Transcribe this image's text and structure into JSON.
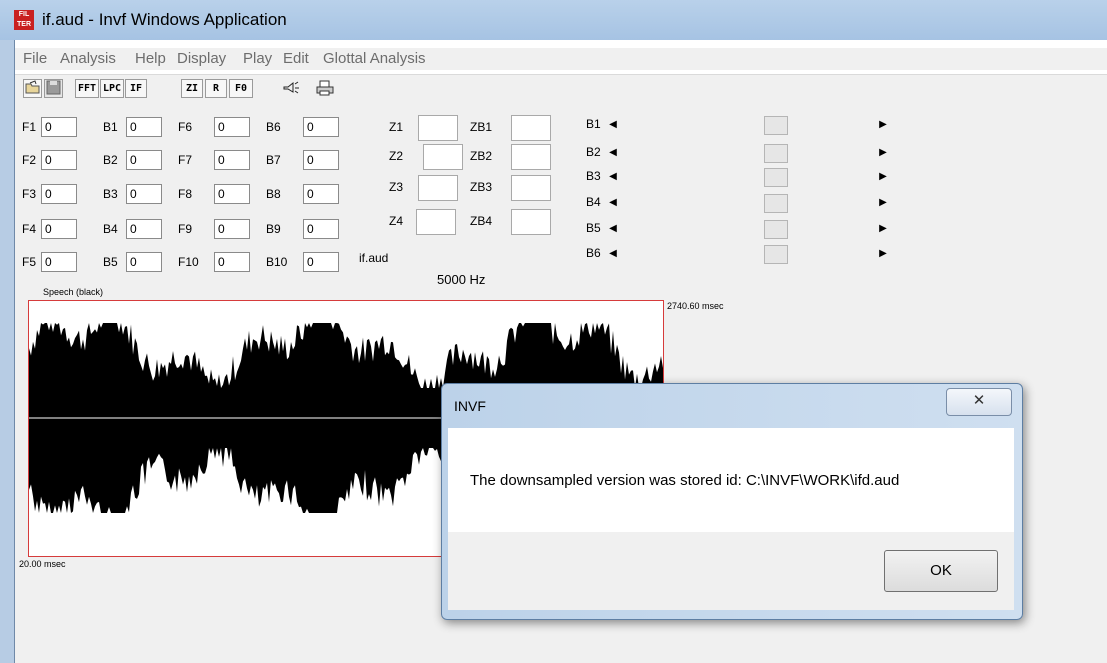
{
  "window": {
    "title": "if.aud - Invf Windows Application",
    "icon_text": "FILTER"
  },
  "menu": [
    "File",
    "Analysis",
    "Help",
    "Display",
    "Play",
    "Edit",
    "Glottal Analysis"
  ],
  "toolbar": [
    "FFT",
    "LPC",
    "IF",
    "ZI",
    "R",
    "F0"
  ],
  "formants": [
    {
      "f": "F1",
      "f_val": "0",
      "b": "B1",
      "b_val": "0",
      "f2": "F6",
      "f2_val": "0",
      "b2": "B6",
      "b2_val": "0"
    },
    {
      "f": "F2",
      "f_val": "0",
      "b": "B2",
      "b_val": "0",
      "f2": "F7",
      "f2_val": "0",
      "b2": "B7",
      "b2_val": "0"
    },
    {
      "f": "F3",
      "f_val": "0",
      "b": "B3",
      "b_val": "0",
      "f2": "F8",
      "f2_val": "0",
      "b2": "B8",
      "b2_val": "0"
    },
    {
      "f": "F4",
      "f_val": "0",
      "b": "B4",
      "b_val": "0",
      "f2": "F9",
      "f2_val": "0",
      "b2": "B9",
      "b2_val": "0"
    },
    {
      "f": "F5",
      "f_val": "0",
      "b": "B5",
      "b_val": "0",
      "f2": "F10",
      "f2_val": "0",
      "b2": "B10",
      "b2_val": "0"
    }
  ],
  "zeros": [
    {
      "z": "Z1",
      "zb": "ZB1"
    },
    {
      "z": "Z2",
      "zb": "ZB2"
    },
    {
      "z": "Z3",
      "zb": "ZB3"
    },
    {
      "z": "Z4",
      "zb": "ZB4"
    }
  ],
  "file_label": "if.aud",
  "sample_rate": "5000 Hz",
  "scrollbars": [
    "B1",
    "B2",
    "B3",
    "B4",
    "B5",
    "B6"
  ],
  "plot": {
    "label": "Speech (black)",
    "end_time": "2740.60 msec",
    "start_time": "20.00 msec"
  },
  "dialog": {
    "title": "INVF",
    "close": "✕",
    "message": "The downsampled version was stored id: C:\\INVF\\WORK\\ifd.aud",
    "ok": "OK"
  },
  "colors": {
    "plot_border": "#d63b3b",
    "waveform": "#000000",
    "title_bar": "#b9d1ea"
  }
}
